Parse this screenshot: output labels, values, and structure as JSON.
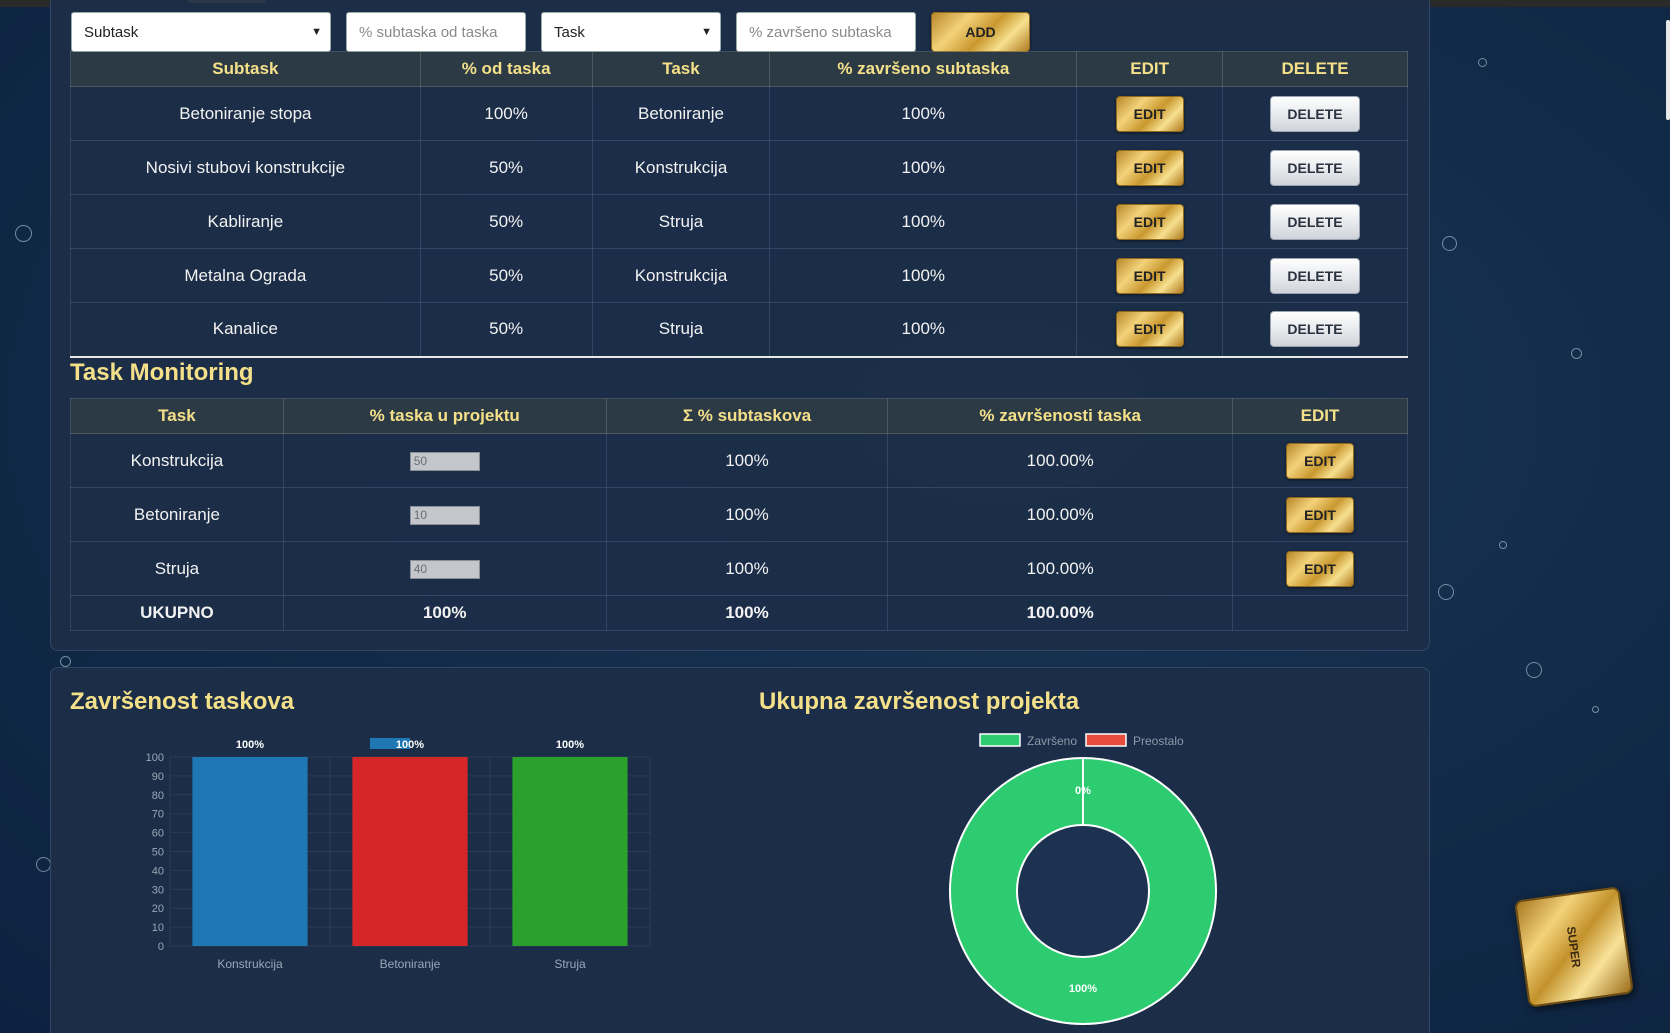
{
  "form": {
    "subtask_select": "Subtask",
    "pct_subtask_placeholder": "% subtaska od taska",
    "task_select": "Task",
    "pct_done_placeholder": "% završeno subtaska",
    "add_label": "ADD"
  },
  "subtask_table": {
    "headers": [
      "Subtask",
      "% od taska",
      "Task",
      "% završeno subtaska",
      "EDIT",
      "DELETE"
    ],
    "edit_label": "EDIT",
    "delete_label": "DELETE",
    "rows": [
      {
        "subtask": "Betoniranje stopa",
        "pct": "100%",
        "task": "Betoniranje",
        "done": "100%"
      },
      {
        "subtask": "Nosivi stubovi konstrukcije",
        "pct": "50%",
        "task": "Konstrukcija",
        "done": "100%"
      },
      {
        "subtask": "Kabliranje",
        "pct": "50%",
        "task": "Struja",
        "done": "100%"
      },
      {
        "subtask": "Metalna Ograda",
        "pct": "50%",
        "task": "Konstrukcija",
        "done": "100%"
      },
      {
        "subtask": "Kanalice",
        "pct": "50%",
        "task": "Struja",
        "done": "100%"
      }
    ]
  },
  "task_monitoring": {
    "title": "Task Monitoring",
    "headers": [
      "Task",
      "% taska u projektu",
      "Σ % subtaskova",
      "% završenosti taska",
      "EDIT"
    ],
    "edit_label": "EDIT",
    "rows": [
      {
        "task": "Konstrukcija",
        "pct_in_project": "50",
        "sum_subtasks": "100%",
        "completion": "100.00%"
      },
      {
        "task": "Betoniranje",
        "pct_in_project": "10",
        "sum_subtasks": "100%",
        "completion": "100.00%"
      },
      {
        "task": "Struja",
        "pct_in_project": "40",
        "sum_subtasks": "100%",
        "completion": "100.00%"
      }
    ],
    "total": {
      "label": "UKUPNO",
      "pct_in_project": "100%",
      "sum_subtasks": "100%",
      "completion": "100.00%"
    }
  },
  "bar_section_title": "Završenost taskova",
  "donut_section_title": "Ukupna završenost projekta",
  "super_label": "SUPER",
  "chart_data": [
    {
      "type": "bar",
      "categories": [
        "Konstrukcija",
        "Betoniranje",
        "Struja"
      ],
      "values": [
        100,
        100,
        100
      ],
      "data_labels": [
        "100%",
        "100%",
        "100%"
      ],
      "colors": [
        "#1f77b4",
        "#d62728",
        "#2ca02c"
      ],
      "ylim": [
        0,
        100
      ],
      "yticks": [
        0,
        10,
        20,
        30,
        40,
        50,
        60,
        70,
        80,
        90,
        100
      ],
      "grid": true,
      "legend_color": "#1f77b4"
    },
    {
      "type": "pie",
      "categories": [
        "Završeno",
        "Preostalo"
      ],
      "values": [
        100,
        0
      ],
      "data_labels": [
        "100%",
        "0%"
      ],
      "colors": [
        "#2ecc71",
        "#e74c3c"
      ],
      "legend_position": "top"
    }
  ]
}
